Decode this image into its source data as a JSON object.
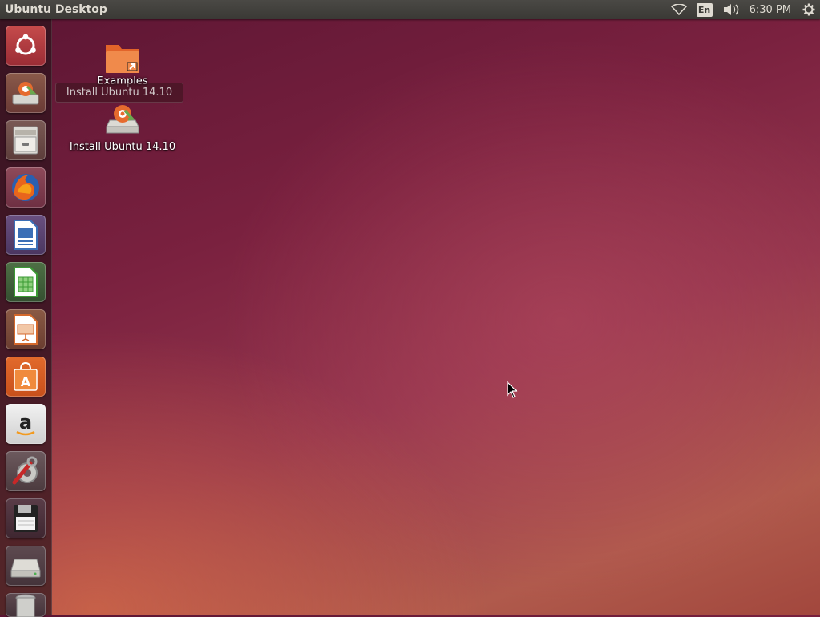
{
  "topbar": {
    "title": "Ubuntu Desktop",
    "indicators": {
      "wifi": "wifi-icon",
      "keyboard_layout": "En",
      "volume": "volume-icon",
      "clock": "6:30 PM",
      "session": "gear-icon"
    }
  },
  "launcher": {
    "items": [
      {
        "name": "dash-home",
        "icon": "ubuntu-logo-icon"
      },
      {
        "name": "install-ubuntu",
        "icon": "installer-icon"
      },
      {
        "name": "files",
        "icon": "file-cabinet-icon"
      },
      {
        "name": "firefox",
        "icon": "firefox-icon"
      },
      {
        "name": "libreoffice-writer",
        "icon": "writer-icon"
      },
      {
        "name": "libreoffice-calc",
        "icon": "calc-icon"
      },
      {
        "name": "libreoffice-impress",
        "icon": "impress-icon"
      },
      {
        "name": "software-center",
        "icon": "shopping-bag-icon"
      },
      {
        "name": "amazon",
        "icon": "amazon-icon"
      },
      {
        "name": "system-settings",
        "icon": "settings-wrench-icon"
      },
      {
        "name": "floppy",
        "icon": "floppy-disk-icon"
      },
      {
        "name": "hard-drive",
        "icon": "hard-drive-icon"
      },
      {
        "name": "trash",
        "icon": "trash-icon"
      }
    ]
  },
  "desktop": {
    "icons": [
      {
        "label": "Examples",
        "icon": "folder-icon"
      },
      {
        "label": "Install Ubuntu 14.10",
        "icon": "installer-icon"
      }
    ],
    "tooltip": "Install Ubuntu 14.10"
  },
  "colors": {
    "panel": "#3c3b37",
    "ubuntu_orange": "#dd4814",
    "wallpaper": "#7a213f"
  }
}
